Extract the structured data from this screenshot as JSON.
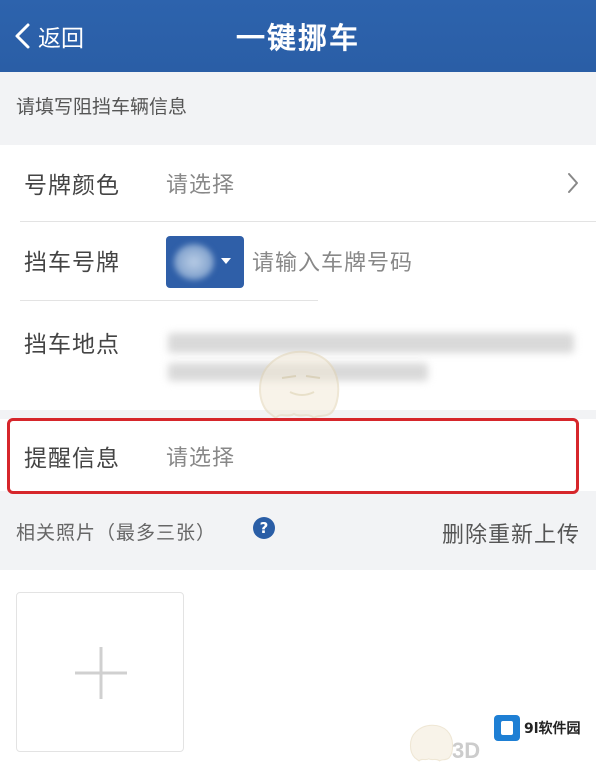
{
  "nav": {
    "back_label": "返回",
    "title": "一键挪车"
  },
  "form": {
    "section_title": "请填写阻挡车辆信息",
    "plate_color": {
      "label": "号牌颜色",
      "value": "请选择"
    },
    "plate_number": {
      "label": "挡车号牌",
      "placeholder": "请输入车牌号码"
    },
    "location": {
      "label": "挡车地点"
    },
    "reminder": {
      "label": "提醒信息",
      "value": "请选择"
    }
  },
  "photos": {
    "title": "相关照片（最多三张）",
    "reupload_label": "删除重新上传"
  },
  "watermark": {
    "site": "9l软件园",
    "mark": "3D"
  },
  "colors": {
    "nav_bg": "#2d63ad",
    "highlight": "#d6262b",
    "help_icon": "#2a5ea6"
  }
}
